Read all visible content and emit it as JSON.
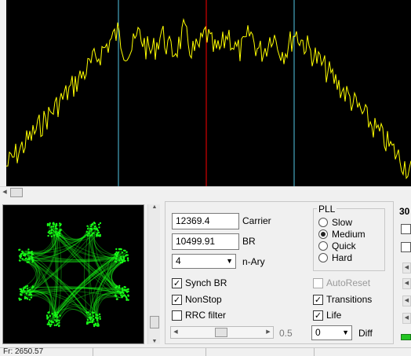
{
  "spectrum": {
    "trace_color": "#ffff00",
    "center_marker_color": "#ff0000",
    "side_marker_color": "#55c8e6",
    "background": "#000000"
  },
  "constellation": {
    "point_color": "#18ff18",
    "background": "#000000"
  },
  "carrier": {
    "value": "12369.4",
    "label": "Carrier"
  },
  "br": {
    "value": "10499.91",
    "label": "BR"
  },
  "nary": {
    "value": "4",
    "label": "n-Ary"
  },
  "pll": {
    "title": "PLL",
    "options": [
      {
        "label": "Slow",
        "selected": false
      },
      {
        "label": "Medium",
        "selected": true
      },
      {
        "label": "Quick",
        "selected": false
      },
      {
        "label": "Hard",
        "selected": false
      }
    ]
  },
  "checks": {
    "synch_br": {
      "label": "Synch BR",
      "checked": true
    },
    "nonstop": {
      "label": "NonStop",
      "checked": true
    },
    "rrc": {
      "label": "RRC filter",
      "checked": false
    },
    "autoreset": {
      "label": "AutoReset",
      "checked": false
    },
    "transitions": {
      "label": "Transitions",
      "checked": true
    },
    "life": {
      "label": "Life",
      "checked": true
    }
  },
  "slider": {
    "value_label": "0.5"
  },
  "diff": {
    "value": "0",
    "label": "Diff"
  },
  "right": {
    "number": "30"
  },
  "status": {
    "text": "Fr: 2650.57"
  }
}
